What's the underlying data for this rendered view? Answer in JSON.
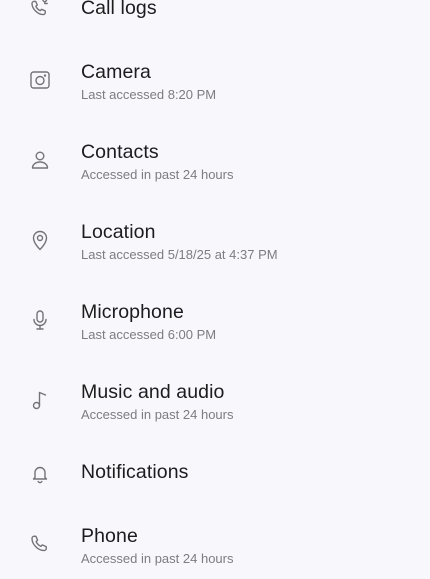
{
  "permissions": {
    "items": [
      {
        "label": "Call logs",
        "icon": "call-log-icon"
      },
      {
        "label": "Camera",
        "subtitle": "Last accessed 8:20 PM",
        "icon": "camera-icon"
      },
      {
        "label": "Contacts",
        "subtitle": "Accessed in past 24 hours",
        "icon": "person-icon"
      },
      {
        "label": "Location",
        "subtitle": "Last accessed 5/18/25 at 4:37 PM",
        "icon": "location-pin-icon"
      },
      {
        "label": "Microphone",
        "subtitle": "Last accessed 6:00 PM",
        "icon": "microphone-icon"
      },
      {
        "label": "Music and audio",
        "subtitle": "Accessed in past 24 hours",
        "icon": "music-note-icon"
      },
      {
        "label": "Notifications",
        "icon": "bell-icon"
      },
      {
        "label": "Phone",
        "subtitle": "Accessed in past 24 hours",
        "icon": "phone-icon"
      }
    ]
  },
  "colors": {
    "background": "#f8f8fc",
    "title": "#1c1c1e",
    "subtitle": "#7d7d80",
    "icon": "#737378"
  }
}
